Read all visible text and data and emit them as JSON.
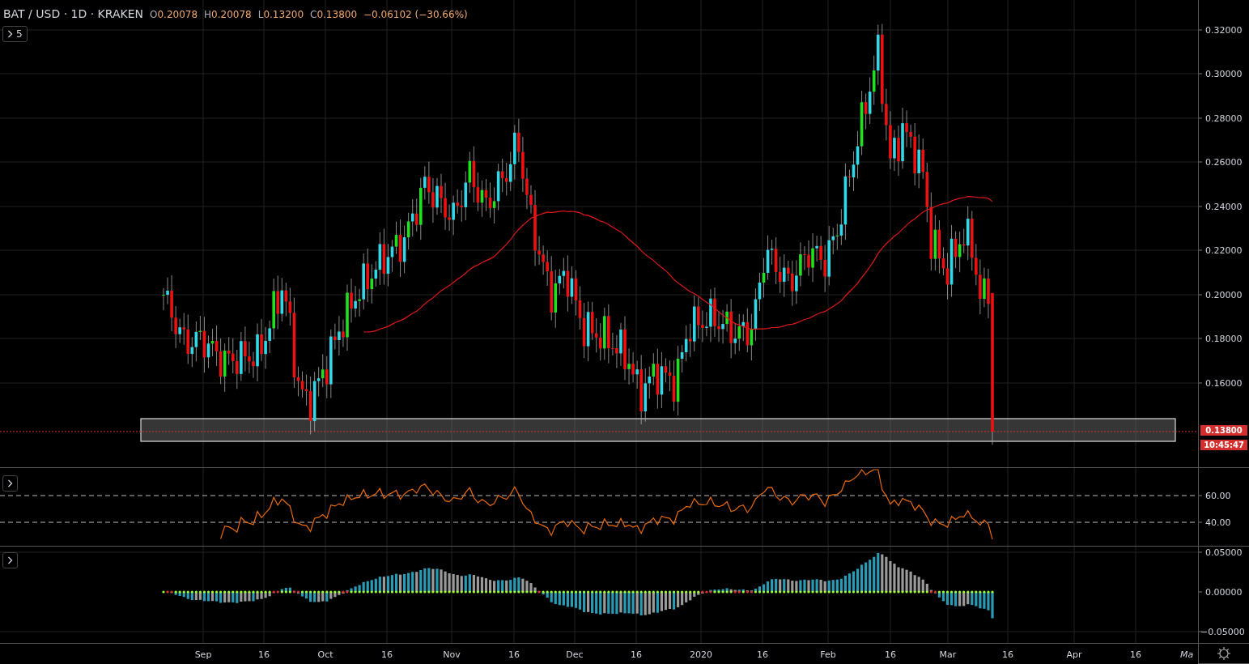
{
  "header": {
    "symbol": "BAT / USD · 1D · KRAKEN",
    "ohlc": [
      {
        "label": "O",
        "value": "0.20078"
      },
      {
        "label": "H",
        "value": "0.20078"
      },
      {
        "label": "L",
        "value": "0.13200"
      },
      {
        "label": "C",
        "value": "0.13800"
      }
    ],
    "change": "−0.06102 (−30.66%)"
  },
  "price_pane": {
    "indicator_count": "5",
    "axis_labels": [
      "0.32000",
      "0.30000",
      "0.28000",
      "0.26000",
      "0.24000",
      "0.22000",
      "0.20000",
      "0.18000",
      "0.16000"
    ],
    "last_price": "0.13800",
    "countdown": "10:45:47"
  },
  "rsi_pane": {
    "axis_labels": [
      "60.00",
      "40.00"
    ]
  },
  "oscillator_pane": {
    "axis_labels": [
      "0.05000",
      "0.00000",
      "−0.05000"
    ]
  },
  "time_axis": {
    "labels": [
      "Sep",
      "16",
      "Oct",
      "16",
      "Nov",
      "16",
      "Dec",
      "16",
      "2020",
      "16",
      "Feb",
      "16",
      "Mar",
      "16",
      "Apr",
      "16",
      "Ma"
    ]
  }
}
